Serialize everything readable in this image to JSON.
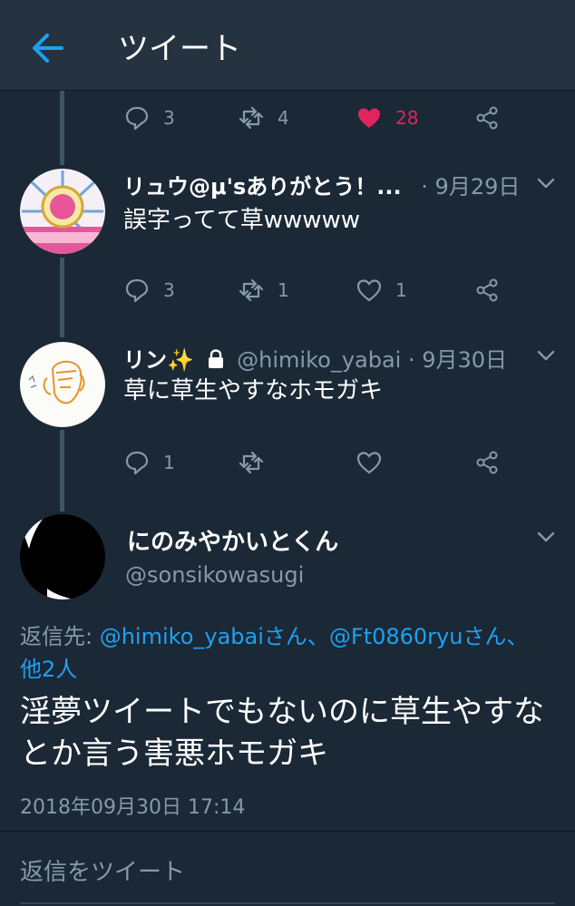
{
  "header": {
    "title": "ツイート",
    "back_icon": "arrow-left-icon"
  },
  "colors": {
    "accent": "#1da1f2",
    "like": "#e0245e",
    "muted": "#8899a6",
    "background": "#1b2836"
  },
  "prev_actions": {
    "reply_count": "3",
    "retweet_count": "4",
    "like_count": "28"
  },
  "tweets": [
    {
      "name": "リュウ@μ'sありがとう！...",
      "handle": "",
      "date": "· 9月29日",
      "text": "誤字ってて草wwwww",
      "reply_count": "3",
      "retweet_count": "1",
      "like_count": "1"
    },
    {
      "name": "リン✨",
      "lock_icon": "lock-icon",
      "handle": "@himiko_yabai",
      "date": "· 9月30日",
      "text": "草に草生やすなホモガキ",
      "reply_count": "1",
      "retweet_count": "",
      "like_count": ""
    }
  ],
  "main_tweet": {
    "name": "にのみやかいとくん",
    "handle": "@sonsikowasugi",
    "reply_prefix": "返信先: ",
    "mention1": "@himiko_yabaiさん",
    "separator": "、",
    "mention2": "@Ft0860ryuさん",
    "separator2": "、",
    "others": "他2人",
    "text": "淫夢ツイートでもないのに草生やすなとか言う害悪ホモガキ",
    "timestamp": "2018年09月30日 17:14"
  },
  "reply_bar": {
    "placeholder": "返信をツイート"
  }
}
